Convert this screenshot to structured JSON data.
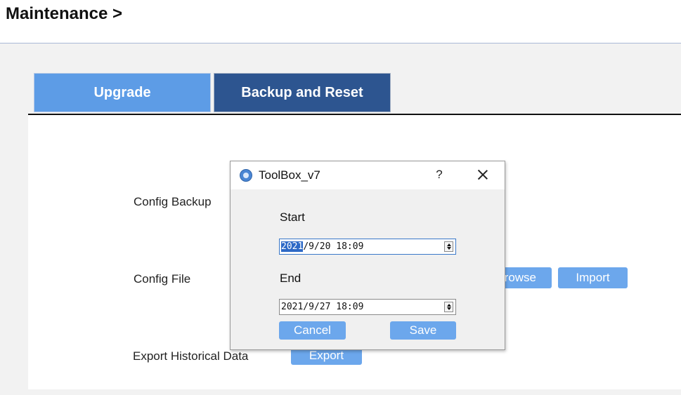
{
  "header": {
    "title": "Maintenance >"
  },
  "tabs": [
    {
      "label": "Upgrade",
      "active": false
    },
    {
      "label": "Backup and Reset",
      "active": true
    }
  ],
  "form": {
    "config_backup_label": "Config Backup",
    "config_file_label": "Config File",
    "browse_label": "Browse",
    "import_label": "Import",
    "export_historical_label": "Export Historical Data",
    "export_label": "Export"
  },
  "dialog": {
    "title": "ToolBox_v7",
    "help": "?",
    "start_label": "Start",
    "start_value_selected": "2021",
    "start_value_rest": "/9/20 18:09",
    "end_label": "End",
    "end_value": "2021/9/27 18:09",
    "cancel_label": "Cancel",
    "save_label": "Save"
  },
  "colors": {
    "primary_button": "#6ca7ec",
    "active_tab": "#2d5590",
    "inactive_tab": "#5d9ce6",
    "selection": "#2d69c6"
  }
}
